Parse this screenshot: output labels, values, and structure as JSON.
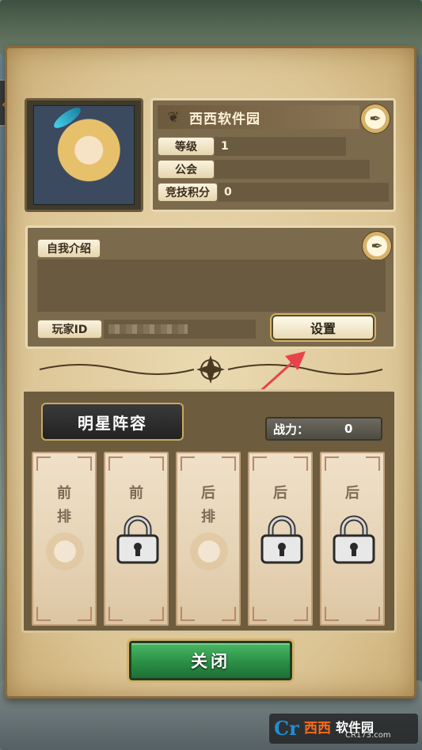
{
  "profile": {
    "player_name": "西西软件园",
    "stats": [
      {
        "label": "等级",
        "value": "1"
      },
      {
        "label": "公会",
        "value": ""
      },
      {
        "label": "竞技积分",
        "value": "0"
      }
    ],
    "edit_icon": "quill-icon"
  },
  "intro": {
    "label": "自我介绍",
    "text": "",
    "edit_icon": "quill-icon"
  },
  "player_id": {
    "label": "玩家ID",
    "value": ""
  },
  "settings_button": "设置",
  "lineup": {
    "title": "明星阵容",
    "power_label": "战力：",
    "power_value": "0",
    "slots": [
      {
        "line1": "前",
        "line2": "排",
        "locked": false
      },
      {
        "line1": "前",
        "line2": "",
        "locked": true
      },
      {
        "line1": "后",
        "line2": "排",
        "locked": false
      },
      {
        "line1": "后",
        "line2": "",
        "locked": true
      },
      {
        "line1": "后",
        "line2": "",
        "locked": true
      }
    ]
  },
  "close_button": "关闭",
  "watermark": {
    "logo": "Cr",
    "brand": "西西",
    "name": "软件园",
    "site": "CR173.com"
  },
  "colors": {
    "parchment": "#dcc595",
    "panel": "#7c6a4d",
    "close_green": "#2a8f45",
    "arrow_red": "#e8424a"
  }
}
